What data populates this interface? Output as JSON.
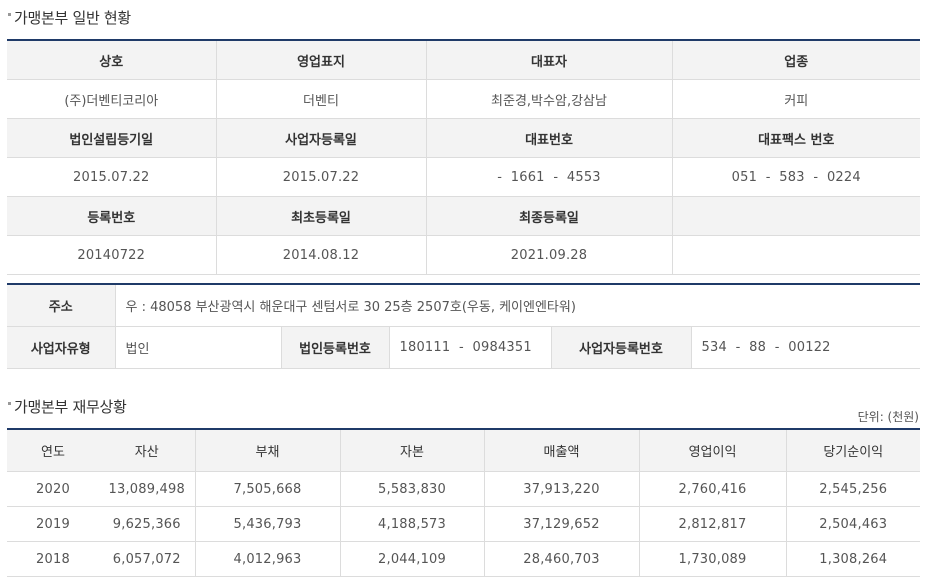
{
  "general": {
    "title": "가맹본부 일반 현황",
    "row1_headers": [
      "상호",
      "영업표지",
      "대표자",
      "업종"
    ],
    "row1_values": [
      "(주)더벤티코리아",
      "더벤티",
      "최준경,박수암,강삼남",
      "커피"
    ],
    "row2_headers": [
      "법인설립등기일",
      "사업자등록일",
      "대표번호",
      "대표팩스 번호"
    ],
    "row2_values": [
      "2015.07.22",
      "2015.07.22",
      "-  1661  -  4553",
      "051  -  583  -  0224"
    ],
    "row3_headers": [
      "등록번호",
      "최초등록일",
      "최종등록일",
      ""
    ],
    "row3_values": [
      "20140722",
      "2014.08.12",
      "2021.09.28",
      ""
    ]
  },
  "address": {
    "label": "주소",
    "value": "우 : 48058 부산광역시 해운대구 센텀서로 30 25층 2507호(우동, 케이엔엔타워)",
    "biz_type_label": "사업자유형",
    "biz_type_value": "법인",
    "corp_reg_label": "법인등록번호",
    "corp_reg_value": "180111  -  0984351",
    "biz_reg_label": "사업자등록번호",
    "biz_reg_value": "534  -  88  -  00122"
  },
  "finance": {
    "title": "가맹본부 재무상황",
    "unit": "단위: (천원)",
    "headers": [
      "연도",
      "자산",
      "부채",
      "자본",
      "매출액",
      "영업이익",
      "당기순이익"
    ],
    "rows": [
      [
        "2020",
        "13,089,498",
        "7,505,668",
        "5,583,830",
        "37,913,220",
        "2,760,416",
        "2,545,256"
      ],
      [
        "2019",
        "9,625,366",
        "5,436,793",
        "4,188,573",
        "37,129,652",
        "2,812,817",
        "2,504,463"
      ],
      [
        "2018",
        "6,057,072",
        "4,012,963",
        "2,044,109",
        "28,460,703",
        "1,730,089",
        "1,308,264"
      ]
    ]
  }
}
